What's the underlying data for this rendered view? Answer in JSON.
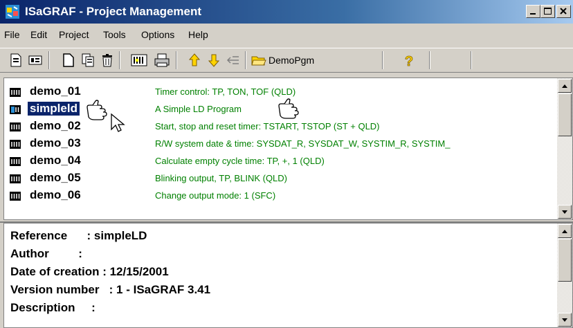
{
  "window": {
    "title": "ISaGRAF - Project Management",
    "minimize_glyph": "_",
    "maximize_glyph": "□",
    "close_glyph": "×"
  },
  "menu": [
    "File",
    "Edit",
    "Project",
    "Tools",
    "Options",
    "Help"
  ],
  "toolbar": {
    "buttons": [
      "new-project-icon",
      "properties-icon",
      "new-document-icon",
      "copy-icon",
      "delete-icon",
      "compile-icon",
      "print-icon",
      "move-up-icon",
      "move-down-icon",
      "indent-icon",
      "open-folder-icon",
      "help-icon"
    ],
    "project_label": "DemoPgm"
  },
  "projects": [
    {
      "name": "demo_01",
      "description": "Timer control: TP, TON, TOF (QLD)",
      "selected": false
    },
    {
      "name": "simpleld",
      "description": "A Simple LD Program",
      "selected": true
    },
    {
      "name": "demo_02",
      "description": "Start, stop and reset timer: TSTART, TSTOP (ST + QLD)",
      "selected": false
    },
    {
      "name": "demo_03",
      "description": "R/W system date & time: SYSDAT_R, SYSDAT_W, SYSTIM_R, SYSTIM_",
      "selected": false
    },
    {
      "name": "demo_04",
      "description": "Calculate empty cycle time: TP, +, 1 (QLD)",
      "selected": false
    },
    {
      "name": "demo_05",
      "description": "Blinking output, TP, BLINK (QLD)",
      "selected": false
    },
    {
      "name": "demo_06",
      "description": "Change output mode: 1 (SFC)",
      "selected": false
    }
  ],
  "info": {
    "reference": "Reference      : simpleLD",
    "author": "Author         :",
    "date": "Date of creation : 12/15/2001",
    "version": "Version number   : 1 - ISaGRAF 3.41",
    "description": "Description     :"
  },
  "colors": {
    "title_start": "#0a246a",
    "selection": "#0a246a",
    "description_text": "#008000",
    "face": "#d4d0c8"
  }
}
